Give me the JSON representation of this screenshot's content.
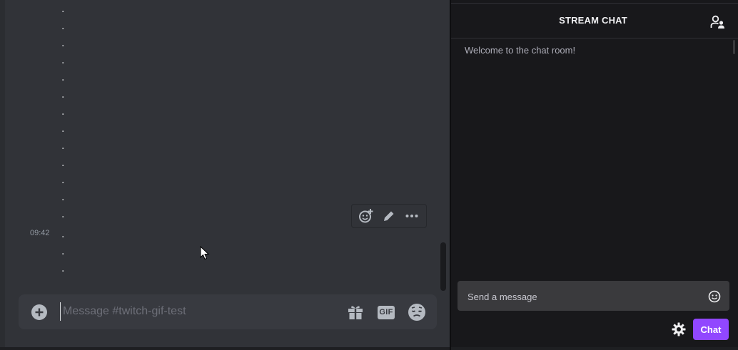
{
  "discord": {
    "message_dots": [
      ".",
      ".",
      ".",
      ".",
      ".",
      ".",
      ".",
      ".",
      ".",
      ".",
      ".",
      ".",
      ".",
      ".",
      ".",
      "."
    ],
    "timestamp": "09:42",
    "toolbar": {
      "icons": [
        "add-reaction-icon",
        "edit-icon",
        "more-icon"
      ]
    },
    "composer": {
      "placeholder": "Message #twitch-gif-test",
      "gif_label": "GIF",
      "icons": [
        "add-circle-icon",
        "gift-icon",
        "gif-icon",
        "emoji-icon"
      ]
    },
    "colors": {
      "background": "#313338",
      "composer": "#383a40"
    }
  },
  "twitch": {
    "header_title": "STREAM CHAT",
    "welcome_message": "Welcome to the chat room!",
    "input_placeholder": "Send a message",
    "send_label": "Chat",
    "icons": [
      "community-users-icon",
      "emoji-icon",
      "settings-icon"
    ],
    "colors": {
      "background": "#18181b",
      "accent": "#9147ff",
      "input": "#3a3a3d"
    }
  }
}
